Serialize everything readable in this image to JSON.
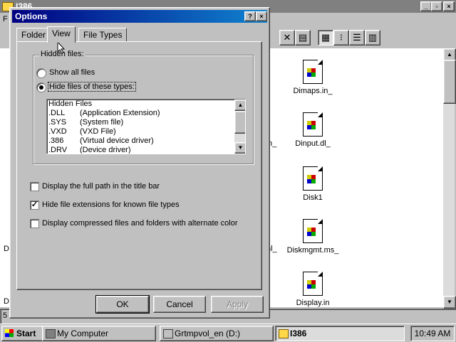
{
  "explorer": {
    "title": "I386",
    "menu_first": "F",
    "status_prefix": "5",
    "toolbar_icons": [
      "delete-icon",
      "properties-icon",
      "large-icons-view-icon",
      "small-icons-view-icon",
      "list-view-icon",
      "details-view-icon"
    ],
    "files": [
      {
        "name": "Dimaps.in_"
      },
      {
        "name": "Dinput.dl_"
      },
      {
        "name": "Disk1"
      },
      {
        "name": "Diskmgmt.ms_"
      },
      {
        "name": "Display.in"
      }
    ],
    "left_fragments": {
      "a": "D",
      "b": "D"
    },
    "mid_fragments": {
      "a": "n_",
      "b": "nl_"
    }
  },
  "dialog": {
    "title": "Options",
    "help_btn": "?",
    "close_btn": "×",
    "tabs": [
      "Folder",
      "View",
      "File Types"
    ],
    "active_tab": "View",
    "group_label": "Hidden files:",
    "radio_show_all": "Show all files",
    "radio_hide": "Hide files of these types:",
    "selected_radio": "hide",
    "hidden_list": [
      {
        "ext": "Hidden Files",
        "desc": ""
      },
      {
        "ext": ".DLL",
        "desc": "(Application Extension)"
      },
      {
        "ext": ".SYS",
        "desc": "(System file)"
      },
      {
        "ext": ".VXD",
        "desc": "(VXD File)"
      },
      {
        "ext": ".386",
        "desc": "(Virtual device driver)"
      },
      {
        "ext": ".DRV",
        "desc": "(Device driver)"
      }
    ],
    "checkboxes": [
      {
        "label": "Display the full path in the title bar",
        "checked": false
      },
      {
        "label": "Hide file extensions for known file types",
        "checked": true
      },
      {
        "label": "Display compressed files and folders with alternate color",
        "checked": false
      }
    ],
    "ok": "OK",
    "cancel": "Cancel",
    "apply": "Apply"
  },
  "taskbar": {
    "start": "Start",
    "tasks": [
      "My Computer",
      "Grtmpvol_en (D:)",
      "I386"
    ],
    "active_task": "I386",
    "clock": "10:49 AM"
  },
  "colors": {
    "title_active": "#000080",
    "desktop": "#008080",
    "face": "#c0c0c0"
  }
}
